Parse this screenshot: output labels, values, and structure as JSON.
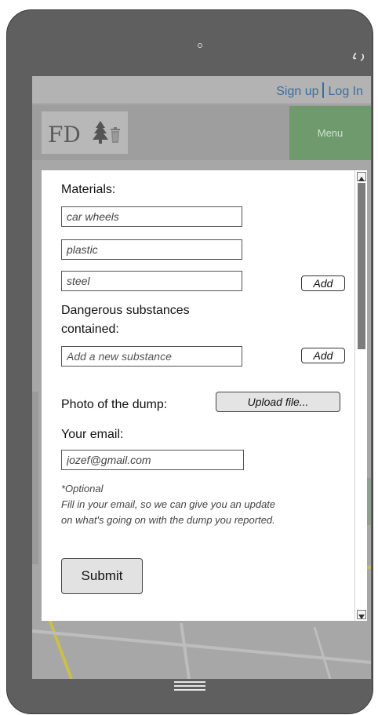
{
  "topbar": {
    "sign_up": "Sign up",
    "log_in": "Log In"
  },
  "header": {
    "logo_text": "FD",
    "menu_label": "Menu"
  },
  "form": {
    "materials_label": "Materials:",
    "materials": [
      {
        "value": "car wheels"
      },
      {
        "value": "plastic"
      },
      {
        "value": "steel"
      }
    ],
    "add_label": "Add",
    "substances_label_line1": "Dangerous substances",
    "substances_label_line2": "contained:",
    "substance_placeholder": "Add a new substance",
    "photo_label": "Photo of the dump:",
    "upload_label": "Upload file...",
    "email_label": "Your email:",
    "email_value": "jozef@gmail.com",
    "note_line1": "*Optional",
    "note_line2": "Fill in your email, so we can give you an update",
    "note_line3": "on what's going on with the dump you reported.",
    "submit_label": "Submit"
  },
  "colors": {
    "link": "#3f6d99",
    "menu_bg": "#6f9a6e",
    "phone_body": "#5f5f5f"
  }
}
